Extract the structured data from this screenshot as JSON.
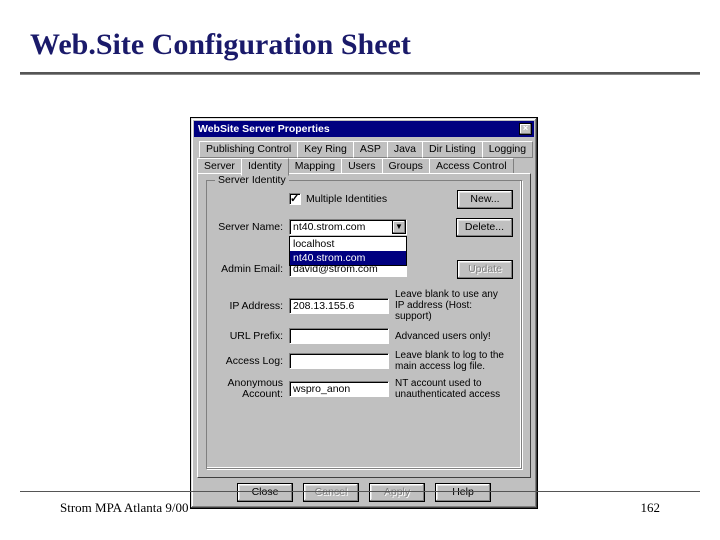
{
  "slide": {
    "title": "Web.Site Configuration Sheet",
    "footer_left": "Strom MPA Atlanta 9/00",
    "footer_right": "162"
  },
  "dialog": {
    "title": "WebSite Server Properties",
    "close_glyph": "×",
    "tabs_row1": [
      "Publishing Control",
      "Key Ring",
      "ASP",
      "Java",
      "Dir Listing",
      "Logging"
    ],
    "tabs_row2": [
      "Server",
      "Identity",
      "Mapping",
      "Users",
      "Groups",
      "Access Control"
    ],
    "active_tab": "Identity",
    "groupbox_label": "Server Identity",
    "multiple_identities_label": "Multiple Identities",
    "multiple_identities_checked": true,
    "buttons": {
      "new": "New...",
      "delete": "Delete...",
      "update": "Update",
      "close": "Close",
      "cancel": "Cancel",
      "apply": "Apply",
      "help": "Help"
    },
    "fields": {
      "server_name": {
        "label": "Server Name:",
        "value": "nt40.strom.com",
        "options": [
          "localhost",
          "nt40.strom.com"
        ],
        "selected_index": 1
      },
      "admin_email": {
        "label": "Admin Email:",
        "value": "david@strom.com"
      },
      "ip_address": {
        "label": "IP Address:",
        "value": "208.13.155.6",
        "hint": "Leave blank to use any IP address (Host: support)"
      },
      "url_prefix": {
        "label": "URL Prefix:",
        "value": "",
        "hint": "Advanced users only!"
      },
      "access_log": {
        "label": "Access Log:",
        "value": "",
        "hint": "Leave blank to log to the main access log file."
      },
      "anon_account": {
        "label": "Anonymous Account:",
        "value": "wspro_anon",
        "hint": "NT account used to unauthenticated access"
      }
    }
  }
}
